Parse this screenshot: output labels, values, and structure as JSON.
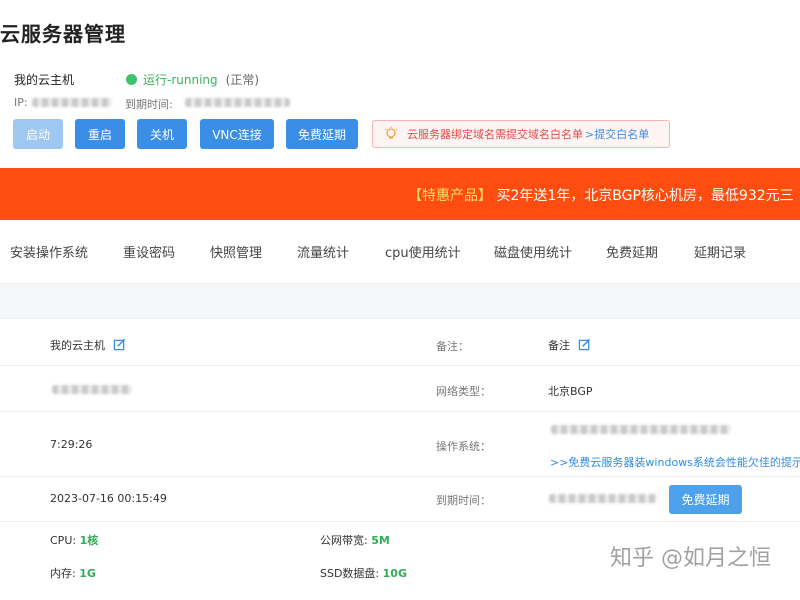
{
  "page": {
    "title": "云服务器管理"
  },
  "server": {
    "name": "我的云主机",
    "status": "运行-running",
    "status_normal": "(正常)",
    "ip_label": "IP:",
    "expire_label": "到期时间:",
    "status_color": "#3ec46d"
  },
  "buttons": {
    "start": "启动",
    "restart": "重启",
    "shutdown": "关机",
    "vnc": "VNC连接",
    "free_renew": "免费延期"
  },
  "notice": {
    "text": "云服务器绑定域名需提交域名白名单",
    "link": ">提交白名单"
  },
  "promo": {
    "tag": "【特惠产品】",
    "text": "买2年送1年，北京BGP核心机房，最低932元三"
  },
  "tabs": [
    "安装操作系统",
    "重设密码",
    "快照管理",
    "流量统计",
    "cpu使用统计",
    "磁盘使用统计",
    "免费延期",
    "延期记录"
  ],
  "details": {
    "name_value": "我的云主机",
    "remark_label": "备注：",
    "remark_value": "备注",
    "network_label": "网络类型：",
    "network_value": "北京BGP",
    "time_value": "7:29:26",
    "os_label": "操作系统：",
    "os_link": ">>免费云服务器装windows系统会性能欠佳的提示",
    "datetime_value": "2023-07-16 00:15:49",
    "expire_label": "到期时间：",
    "renew_button": "免费延期",
    "cpu_label": "CPU:",
    "cpu_value": "1核",
    "bandwidth_label": "公网带宽:",
    "bandwidth_value": "5M",
    "memory_label": "内存:",
    "memory_value": "1G",
    "ssd_label": "SSD数据盘:",
    "ssd_value": "10G"
  },
  "watermark": "知乎 @如月之恒"
}
